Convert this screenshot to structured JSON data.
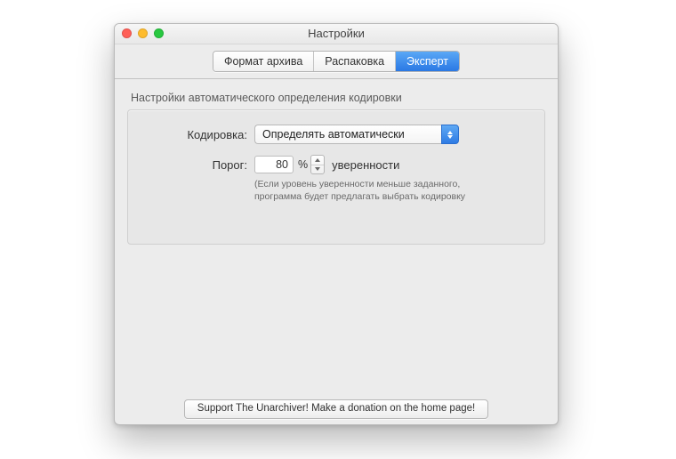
{
  "window": {
    "title": "Настройки"
  },
  "tabs": {
    "archive_format": "Формат архива",
    "extraction": "Распаковка",
    "expert": "Эксперт",
    "active": "expert"
  },
  "section": {
    "heading": "Настройки автоматического определения кодировки"
  },
  "encoding": {
    "label": "Кодировка:",
    "value": "Определять автоматически"
  },
  "threshold": {
    "label": "Порог:",
    "value": "80",
    "percent_sign": "%",
    "suffix": "уверенности",
    "hint_line1": "(Если уровень уверенности меньше заданного,",
    "hint_line2": "программа будет предлагать выбрать кодировку"
  },
  "footer": {
    "donate": "Support The Unarchiver! Make a donation on the home page!"
  }
}
